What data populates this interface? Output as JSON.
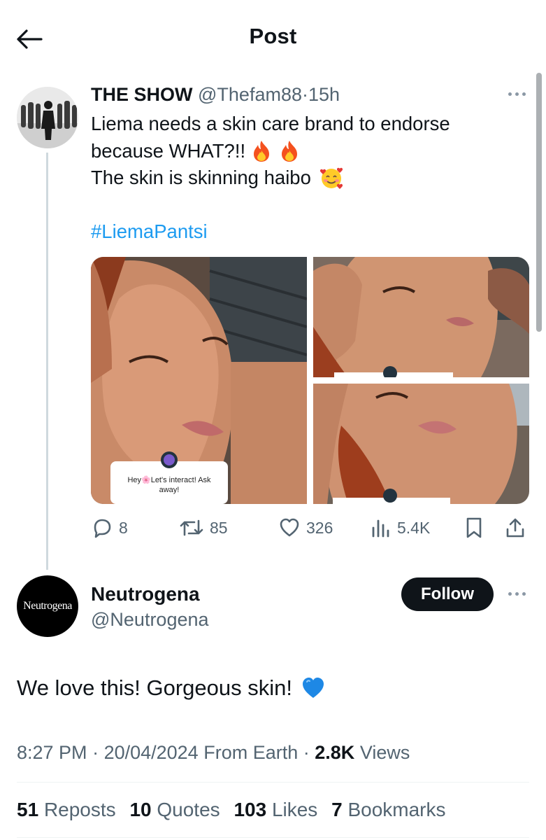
{
  "header": {
    "title": "Post"
  },
  "tweet": {
    "name": "THE SHOW",
    "handle": "@Thefam88",
    "separator": "·",
    "time": "15h",
    "line1": "Liema needs a skin care brand to endorse",
    "line2": "because WHAT?!!",
    "line3": "The skin is skinning haibo",
    "hashtag": "#LiemaPantsi",
    "media_overlay_text": "Hey🌸Let's interact! Ask away!",
    "actions": {
      "replies": "8",
      "reposts": "85",
      "likes": "326",
      "views": "5.4K"
    }
  },
  "reply": {
    "name": "Neutrogena",
    "handle": "@Neutrogena",
    "avatar_text": "Neutrogena",
    "follow_label": "Follow",
    "text": "We love this! Gorgeous skin!",
    "time": "8:27 PM",
    "date": "20/04/2024",
    "location": "From Earth",
    "views_count": "2.8K",
    "views_label": "Views",
    "stats": {
      "reposts_count": "51",
      "reposts_label": "Reposts",
      "quotes_count": "10",
      "quotes_label": "Quotes",
      "likes_count": "103",
      "likes_label": "Likes",
      "bookmarks_count": "7",
      "bookmarks_label": "Bookmarks"
    }
  },
  "colors": {
    "link": "#1d9bf0",
    "secondary_text": "#536471",
    "primary_text": "#0f1419",
    "follow_bg": "#0f1419"
  }
}
